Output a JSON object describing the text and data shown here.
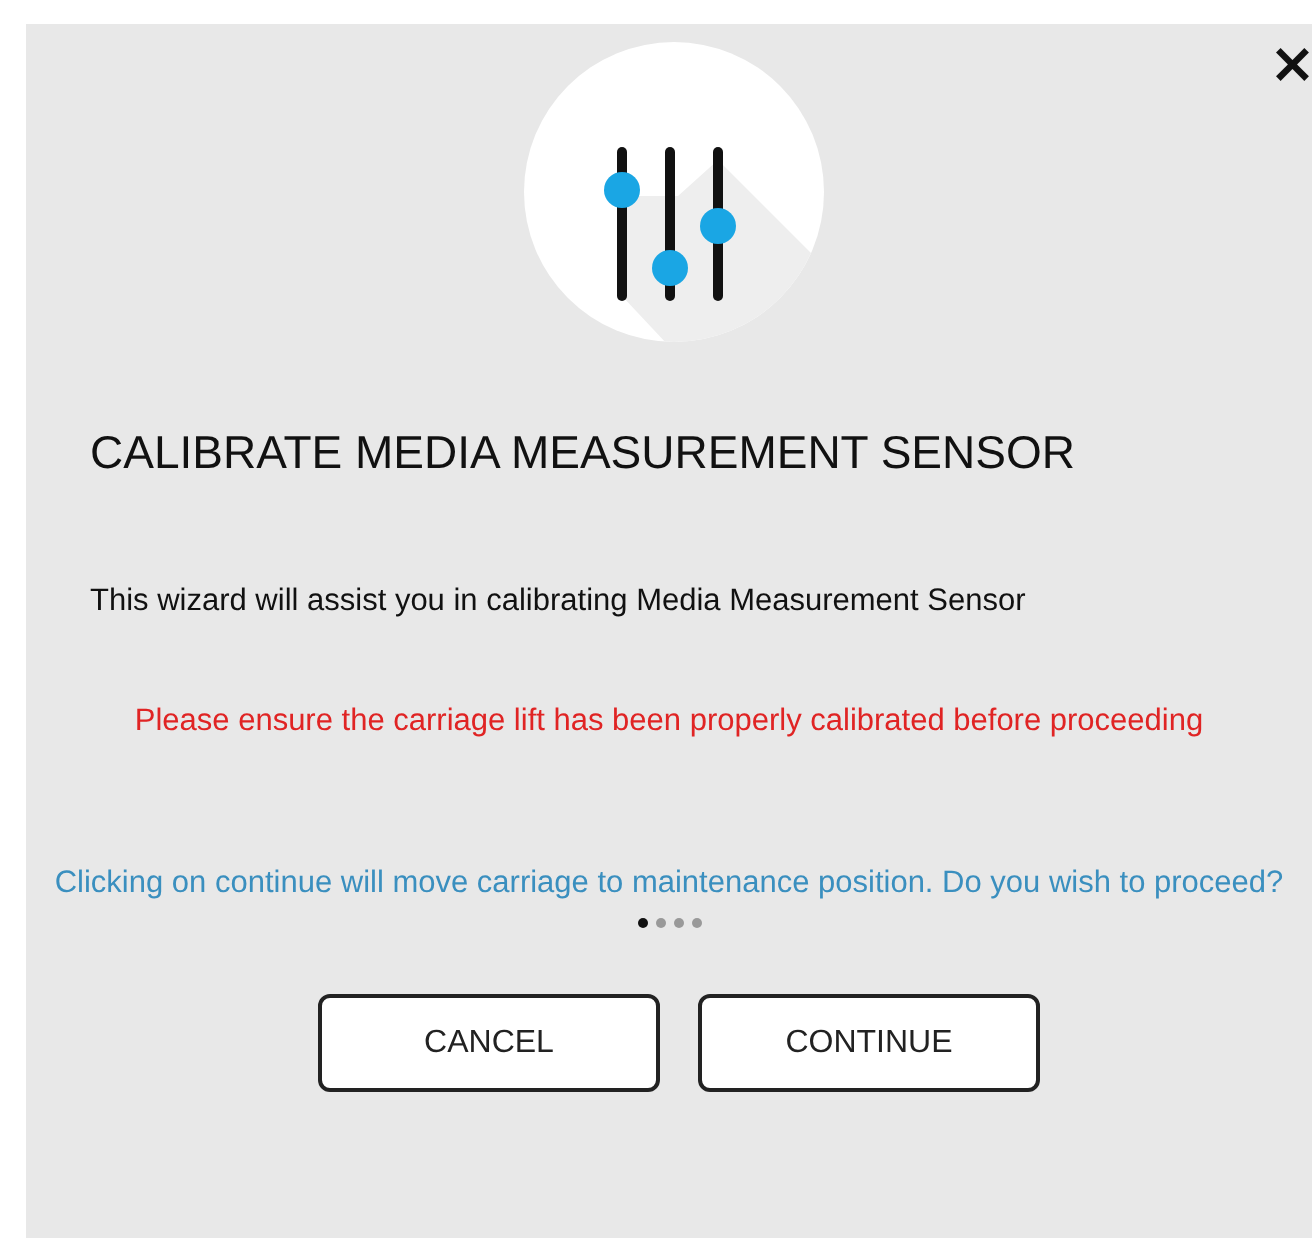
{
  "dialog": {
    "close": "×",
    "title": "CALIBRATE MEDIA MEASUREMENT SENSOR",
    "intro": "This wizard will assist you in calibrating Media Measurement Sensor",
    "warning": "Please ensure the carriage lift has been properly calibrated before proceeding",
    "prompt": "Clicking on continue will move carriage to maintenance position. Do you wish to proceed?",
    "steps": [
      {
        "selected": true
      },
      {
        "selected": false
      },
      {
        "selected": false
      },
      {
        "selected": false
      }
    ],
    "buttons": [
      "CANCEL",
      "CONTINUE"
    ]
  }
}
